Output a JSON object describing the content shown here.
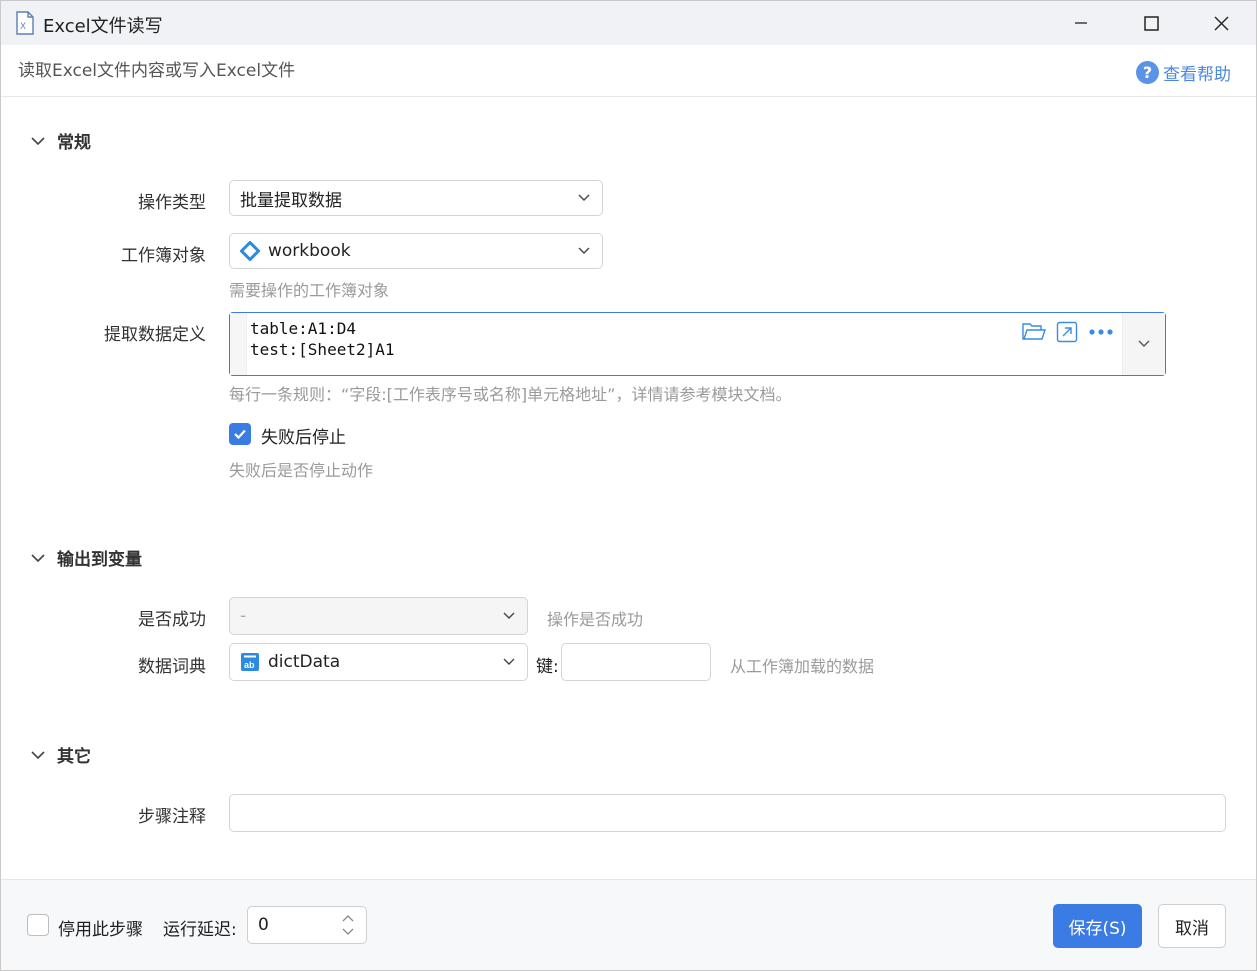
{
  "window": {
    "title": "Excel文件读写"
  },
  "header": {
    "subtitle": "读取Excel文件内容或写入Excel文件",
    "help_label": "查看帮助"
  },
  "sections": {
    "general": {
      "title": "常规",
      "op_type": {
        "label": "操作类型",
        "value": "批量提取数据"
      },
      "workbook": {
        "label": "工作簿对象",
        "value": "workbook",
        "hint": "需要操作的工作簿对象"
      },
      "extract": {
        "label": "提取数据定义",
        "line1": "table:A1:D4",
        "line2": "test:[Sheet2]A1",
        "hint": "每行一条规则：“字段:[工作表序号或名称]单元格地址”，详情请参考模块文档。"
      },
      "stop_on_fail": {
        "label": "失败后停止",
        "checked": true,
        "hint": "失败后是否停止动作"
      }
    },
    "output": {
      "title": "输出到变量",
      "success": {
        "label": "是否成功",
        "value": "-",
        "hint": "操作是否成功"
      },
      "dict": {
        "label": "数据词典",
        "value": "dictData",
        "key_label": "键:",
        "key_value": "",
        "hint": "从工作簿加载的数据"
      }
    },
    "other": {
      "title": "其它",
      "comment": {
        "label": "步骤注释",
        "value": ""
      }
    }
  },
  "footer": {
    "disable_label": "停用此步骤",
    "delay_label": "运行延迟:",
    "delay_value": "0",
    "save_label": "保存(S)",
    "cancel_label": "取消"
  },
  "colors": {
    "accent": "#3b7be4",
    "help": "#4a88e0",
    "workbook_icon": "#2b8be0"
  }
}
